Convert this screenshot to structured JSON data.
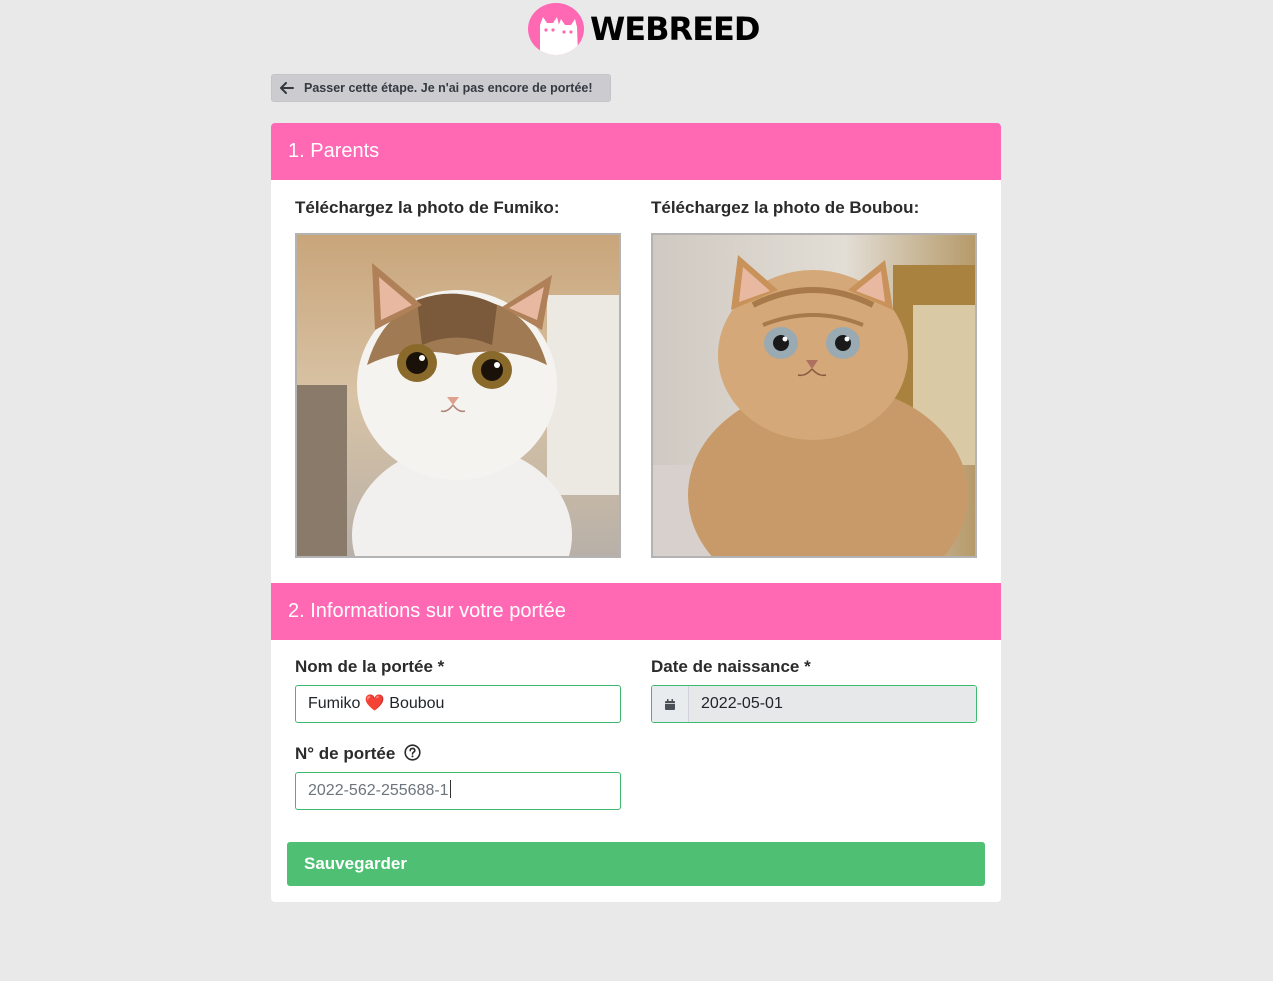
{
  "brand": {
    "name": "WEBREED",
    "color": "#ff69b4"
  },
  "skip_button": {
    "label": "Passer cette étape. Je n'ai pas encore de portée!",
    "icon": "arrow-left-icon"
  },
  "section1": {
    "title": "1. Parents",
    "parent1": {
      "label": "Téléchargez la photo de Fumiko:",
      "photo": "cat-photo-fumiko"
    },
    "parent2": {
      "label": "Téléchargez la photo de Boubou:",
      "photo": "cat-photo-boubou"
    }
  },
  "section2": {
    "title": "2. Informations sur votre portée",
    "litter_name": {
      "label": "Nom de la portée *",
      "value_before": "Fumiko ",
      "emoji": "❤️",
      "value_after": " Boubou"
    },
    "birth_date": {
      "label": "Date de naissance *",
      "value": "2022-05-01",
      "icon": "calendar-icon"
    },
    "litter_number": {
      "label": "N° de portée",
      "value": "2022-562-255688-1",
      "icon": "help-circle-icon"
    }
  },
  "save_button": {
    "label": "Sauvegarder",
    "color": "#4fbf74"
  }
}
